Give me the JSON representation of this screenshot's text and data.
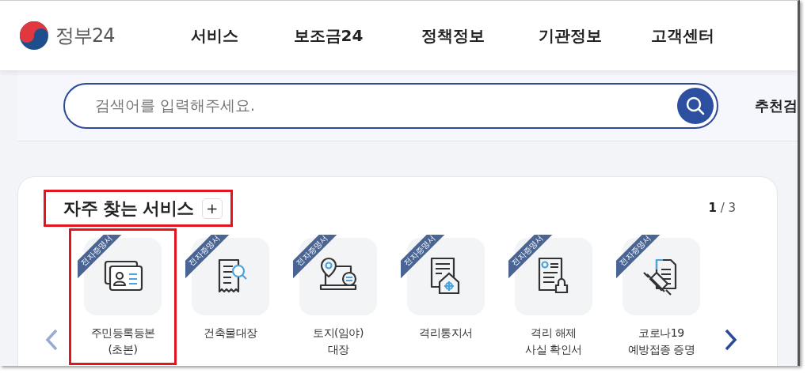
{
  "header": {
    "logo_text": "정부24",
    "nav": [
      {
        "label": "서비스"
      },
      {
        "label": "보조금24"
      },
      {
        "label": "정책정보"
      },
      {
        "label": "기관정보"
      },
      {
        "label": "고객센터"
      }
    ]
  },
  "search": {
    "placeholder": "검색어를 입력해주세요.",
    "side_label": "추천검"
  },
  "section": {
    "title": "자주 찾는 서비스",
    "highlighted": true,
    "add_button": "+",
    "page_current": "1",
    "page_total": "/ 3",
    "items": [
      {
        "badge": "전자증명서",
        "lines": [
          "주민등록등본",
          "(초본)"
        ],
        "highlighted": true
      },
      {
        "badge": "전자증명서",
        "lines": [
          "건축물대장"
        ],
        "highlighted": false
      },
      {
        "badge": "전자증명서",
        "lines": [
          "토지(임야)",
          "대장"
        ],
        "highlighted": false
      },
      {
        "badge": "전자증명서",
        "lines": [
          "격리통지서"
        ],
        "highlighted": false
      },
      {
        "badge": "전자증명서",
        "lines": [
          "격리 해제",
          "사실 확인서"
        ],
        "highlighted": false
      },
      {
        "badge": "전자증명서",
        "lines": [
          "코로나19",
          "예방접종 증명"
        ],
        "highlighted": false
      }
    ]
  }
}
